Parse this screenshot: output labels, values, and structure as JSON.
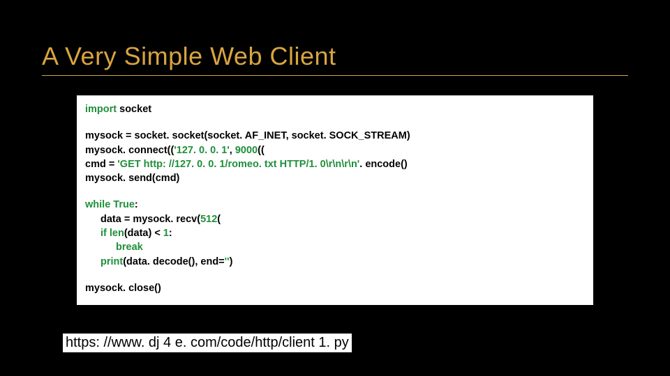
{
  "slide": {
    "title": "A Very Simple Web Client",
    "url": "https: //www. dj 4 e. com/code/http/client 1. py"
  },
  "code": {
    "l1_kw": "import",
    "l1_rest": " socket",
    "l2": "mysock = socket. socket(socket. AF_INET, socket. SOCK_STREAM)",
    "l3a": "mysock. connect((",
    "l3b": "'127. 0. 0. 1'",
    "l3c": ", ",
    "l3d": "9000",
    "l3e": "((",
    "l4a": "cmd = ",
    "l4b": "'GET http: //127. 0. 0. 1/romeo. txt HTTP/1. 0\\r\\n\\r\\n'",
    "l4c": ". encode()",
    "l5": "mysock. send(cmd)",
    "l6a": "while ",
    "l6b": "True",
    "l6c": ":",
    "l7a": "data = mysock. recv(",
    "l7b": "512",
    "l7c": "(",
    "l8a": "if ",
    "l8b": "len",
    "l8c": "(data) < ",
    "l8d": "1",
    "l8e": ":",
    "l9": "break",
    "l10a": "print",
    "l10b": "(data. decode(), end=",
    "l10c": "''",
    "l10d": ")",
    "l11": "mysock. close()"
  }
}
